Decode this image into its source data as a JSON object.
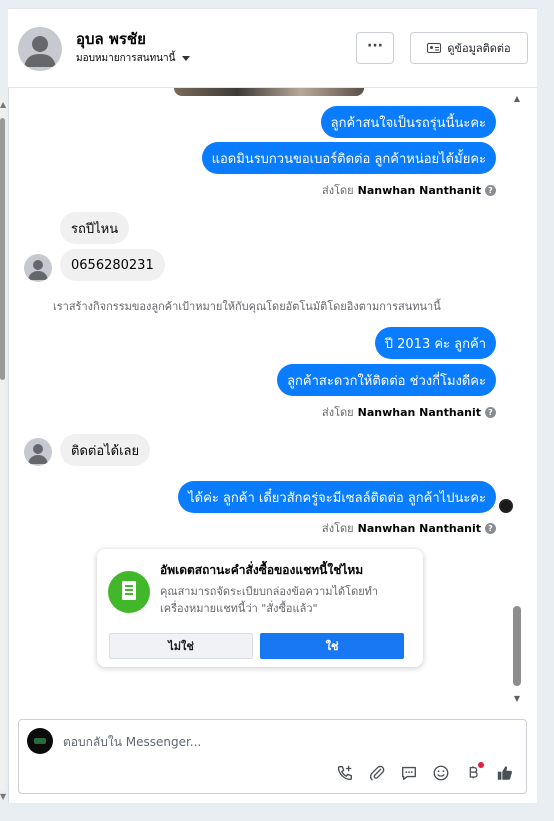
{
  "header": {
    "contact_name": "อุบล พรชัย",
    "assign_label": "มอบหมายการสนทนานี้",
    "more_label": "···",
    "view_contact_label": "ดูข้อมูลติดต่อ"
  },
  "messages": {
    "out_1": "ลูกค้าสนใจเป็นรถรุ่นนี้นะคะ",
    "out_2": "แอดมินรบกวนขอเบอร์ติดต่อ ลูกค้าหน่อยได้มั้ยคะ",
    "sent_by_1": {
      "prefix": "ส่งโดย",
      "name": "Nanwhan Nanthanit"
    },
    "in_1": "รถปีไหน",
    "in_2": "0656280231",
    "system_note": "เราสร้างกิจกรรมของลูกค้าเป้าหมายให้กับคุณโดยอัตโนมัติโดยอิงตามการสนทนานี้",
    "out_3": "ปี  2013 ค่ะ ลูกค้า",
    "out_4": "ลูกค้าสะดวกให้ติดต่อ ช่วงกี่โมงดีคะ",
    "sent_by_2": {
      "prefix": "ส่งโดย",
      "name": "Nanwhan Nanthanit"
    },
    "in_3": "ติดต่อได้เลย",
    "out_5": "ได้ค่ะ ลูกค้า เดี๋ยวสักครู่จะมีเซลล์ติดต่อ ลูกค้าไปนะคะ",
    "sent_by_3": {
      "prefix": "ส่งโดย",
      "name": "Nanwhan Nanthanit"
    }
  },
  "order_card": {
    "title": "อัพเดตสถานะคำสั่งซื้อของแชทนี้ใช่ไหม",
    "description": "คุณสามารถจัดระเบียบกล่องข้อความได้โดยทำเครื่องหมายแชทนี้ว่า \"สั่งซื้อแล้ว\"",
    "no_label": "ไม่ใช่",
    "yes_label": "ใช่"
  },
  "composer": {
    "placeholder": "ตอบกลับใน Messenger...",
    "icons": [
      "call-add-icon",
      "attachment-icon",
      "saved-replies-icon",
      "emoji-icon",
      "payment-icon",
      "like-icon"
    ]
  },
  "colors": {
    "outgoing_bubble": "#0a7cff",
    "incoming_bubble": "#f0f0f0",
    "primary_button": "#1877f2",
    "order_icon": "#42b72a"
  }
}
